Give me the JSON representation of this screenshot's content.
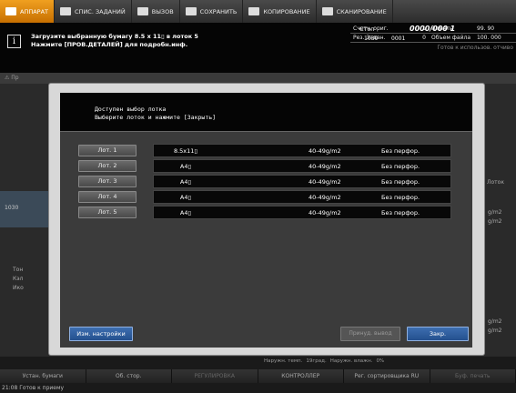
{
  "topnav": {
    "tabs": [
      {
        "label": "АППАРАТ",
        "icon": "machine-icon"
      },
      {
        "label": "СПИС. ЗАДАНИЙ",
        "icon": "job-list-icon"
      },
      {
        "label": "ВЫЗОВ",
        "icon": "recall-icon"
      },
      {
        "label": "СОХРАНИТЬ",
        "icon": "save-icon"
      },
      {
        "label": "КОПИРОВАНИЕ",
        "icon": "copy-icon"
      },
      {
        "label": "СКАНИРОВАНИЕ",
        "icon": "scan-icon"
      }
    ]
  },
  "message": {
    "line1": "Загрузите выбранную бумагу 8.5 x 11▯ в лоток 5",
    "line2": "Нажмите [ПРОВ.ДЕТАЛЕЙ] для подробн.инф."
  },
  "status": {
    "mode": "Стоп",
    "counter": "0000/000 1",
    "job_id": "1030",
    "job_num": "0001",
    "count_orig_label": "Счетч. ориг.",
    "count_orig_value": "1",
    "memory_label": "Память",
    "memory_value": "99. 90",
    "job_res_label": "Рез. Задан.",
    "job_res_value": "0",
    "file_vol_label": "Объем файла",
    "file_vol_value": "100. 000",
    "ready_text": "Готов к использов. отчиво"
  },
  "background": {
    "warn_text": "Пр",
    "left_label": "1030",
    "left_items": [
      "Тон",
      "Кэл",
      "Ико"
    ],
    "right_items": [
      "g/m2",
      "g/m2",
      "g/m2",
      "g/m2"
    ],
    "right_label": "Лоток"
  },
  "dialog": {
    "header_line1": "Доступен выбор лотка",
    "header_line2": "Выберите лоток и нажмите [Закрыть]",
    "trays": [
      {
        "label": "Лот. 1",
        "size": "8.5x11▯",
        "weight": "40-49g/m2",
        "punch": "Без перфор."
      },
      {
        "label": "Лот. 2",
        "size": "A4▯",
        "weight": "40-49g/m2",
        "punch": "Без перфор."
      },
      {
        "label": "Лот. 3",
        "size": "A4▯",
        "weight": "40-49g/m2",
        "punch": "Без перфор."
      },
      {
        "label": "Лот. 4",
        "size": "A4▯",
        "weight": "40-49g/m2",
        "punch": "Без перфор."
      },
      {
        "label": "Лот. 5",
        "size": "A4▯",
        "weight": "40-49g/m2",
        "punch": "Без перфор."
      }
    ],
    "settings_label": "Изм. настройки",
    "force_label": "Принуд. вывод",
    "close_label": "Закр."
  },
  "bottom": {
    "row1": [
      "Наружн. темп.",
      "19град.",
      "Наружн. влажн.",
      "0%"
    ],
    "tabs": [
      "Устан. бумаги",
      "Об. стор.",
      "РЕГУЛИРОВКА",
      "КОНТРОЛЛЕР",
      "Рег. сортировщика RU",
      "Буф. печать"
    ],
    "footer": "21:08  Готов к приему"
  },
  "colors": {
    "accent_orange": "#e08a10",
    "button_blue": "#2f5f9f"
  }
}
